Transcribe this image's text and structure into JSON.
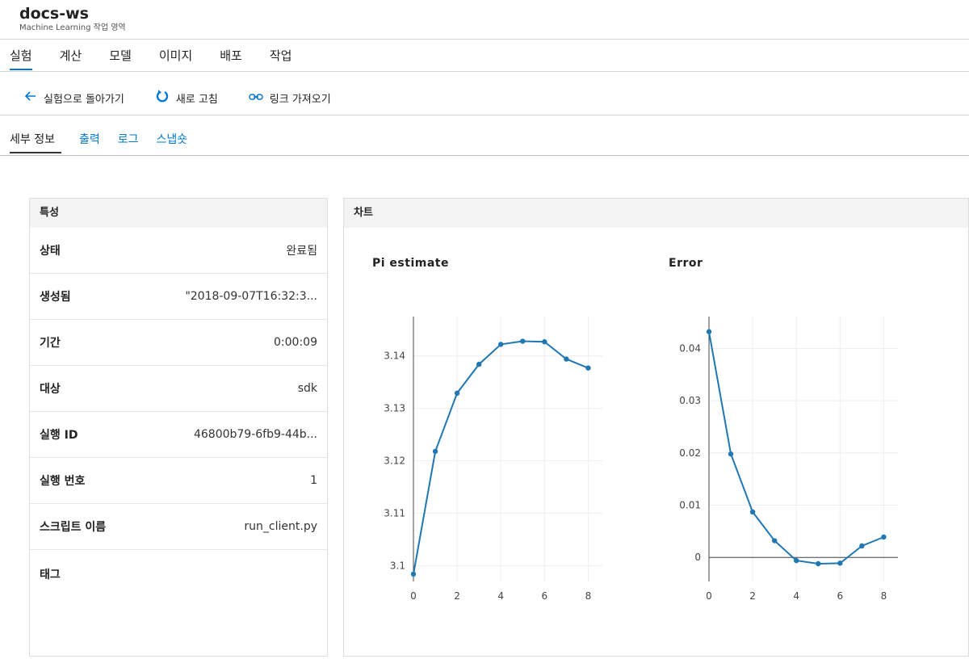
{
  "workspace": {
    "title": "docs-ws",
    "subtitle": "Machine Learning 작업 영역"
  },
  "nav": [
    "실험",
    "계산",
    "모델",
    "이미지",
    "배포",
    "작업"
  ],
  "toolbar": {
    "back_label": "실험으로 돌아가기",
    "refresh_label": "새로 고침",
    "link_label": "링크 가져오기",
    "back_icon": "arrow-left-icon",
    "refresh_icon": "refresh-icon",
    "link_icon": "link-icon"
  },
  "subtabs": [
    "세부 정보",
    "출력",
    "로그",
    "스냅숏"
  ],
  "properties": {
    "header": "특성",
    "rows": [
      {
        "key": "상태",
        "value": "완료됨"
      },
      {
        "key": "생성됨",
        "value": "\"2018-09-07T16:32:3..."
      },
      {
        "key": "기간",
        "value": "0:00:09"
      },
      {
        "key": "대상",
        "value": "sdk"
      },
      {
        "key": "실행 ID",
        "value": "46800b79-6fb9-44b..."
      },
      {
        "key": "실행 번호",
        "value": "1"
      },
      {
        "key": "스크립트 이름",
        "value": "run_client.py"
      }
    ],
    "tags_label": "태그"
  },
  "charts_header": "차트",
  "accent_color": "#0078d4",
  "line_color": "#1f77b4",
  "chart_data": [
    {
      "type": "line",
      "title": "Pi estimate",
      "x": [
        0,
        1,
        2,
        3,
        4,
        5,
        6,
        7,
        8
      ],
      "series": [
        {
          "values": [
            3.0984,
            3.1218,
            3.1329,
            3.1384,
            3.1422,
            3.1428,
            3.1427,
            3.1394,
            3.1377
          ]
        }
      ],
      "xticks": [
        0,
        2,
        4,
        6,
        8
      ],
      "yticks": [
        3.1,
        3.11,
        3.12,
        3.13,
        3.14
      ],
      "ytick_labels": [
        "3.1",
        "3.11",
        "3.12",
        "3.13",
        "3.14"
      ],
      "xlim": [
        0,
        8.65
      ],
      "ylim": [
        3.097,
        3.1475
      ],
      "grid": true
    },
    {
      "type": "line",
      "title": "Error",
      "x": [
        0,
        1,
        2,
        3,
        4,
        5,
        6,
        7,
        8
      ],
      "series": [
        {
          "values": [
            0.0432,
            0.0198,
            0.0087,
            0.0032,
            -0.0006,
            -0.0012,
            -0.0011,
            0.0022,
            0.0039
          ]
        }
      ],
      "xticks": [
        0,
        2,
        4,
        6,
        8
      ],
      "yticks": [
        0,
        0.01,
        0.02,
        0.03,
        0.04
      ],
      "ytick_labels": [
        "0",
        "0.01",
        "0.02",
        "0.03",
        "0.04"
      ],
      "xlim": [
        0,
        8.65
      ],
      "ylim": [
        -0.0046,
        0.0461
      ],
      "grid": true
    }
  ]
}
